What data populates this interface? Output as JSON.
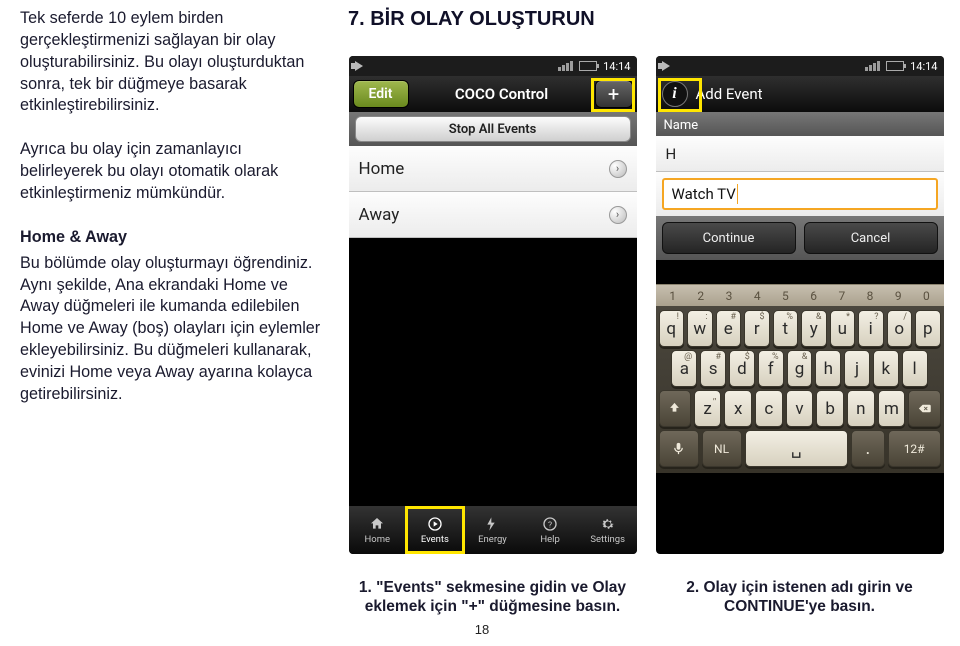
{
  "title": "7. BİR OLAY OLUŞTURUN",
  "para1a": "Tek seferde 10 eylem birden gerçekleştirmenizi sağlayan bir olay oluşturabilirsiniz. Bu olayı oluşturduktan sonra, tek bir düğmeye basarak etkinleştirebilirsiniz.",
  "para1b": "Ayrıca bu olay için zamanlayıcı belirleyerek bu olayı otomatik olarak etkinleştirmeniz mümkündür.",
  "subhead": "Home & Away",
  "para2": "Bu bölümde olay oluşturmayı öğrendiniz. Aynı şekilde, Ana ekrandaki Home ve Away düğmeleri ile kumanda edilebilen Home ve Away (boş) olayları için eylemler ekleyebilirsiniz. Bu düğmeleri kullanarak, evinizi Home veya Away ayarına kolayca getirebilirsiniz.",
  "caption1": "1. \"Events\" sekmesine gidin ve Olay eklemek için \"+\" düğmesine basın.",
  "caption2": "2. Olay için istenen adı girin ve CONTINUE'ye basın.",
  "page_num": "18",
  "phone_a": {
    "time": "14:14",
    "edit": "Edit",
    "header": "COCO Control",
    "plus": "+",
    "stop_all": "Stop All Events",
    "row1": "Home",
    "row2": "Away",
    "tabs": [
      "Home",
      "Events",
      "Energy",
      "Help",
      "Settings"
    ]
  },
  "phone_b": {
    "time": "14:14",
    "header": "Add Event",
    "name_label": "Name",
    "input_text": "Watch TV",
    "continue": "Continue",
    "cancel": "Cancel",
    "row_hint": "H",
    "strip": [
      "1",
      "2",
      "3",
      "4",
      "5",
      "6",
      "7",
      "8",
      "9",
      "0"
    ],
    "r1": [
      [
        "q",
        "!"
      ],
      [
        "w",
        ":"
      ],
      [
        "e",
        "#"
      ],
      [
        "r",
        "$"
      ],
      [
        "t",
        "%"
      ],
      [
        "y",
        "&"
      ],
      [
        "u",
        "*"
      ],
      [
        "i",
        "?"
      ],
      [
        "o",
        "/"
      ],
      [
        "p",
        ""
      ]
    ],
    "r2": [
      [
        "a",
        "@"
      ],
      [
        "s",
        "#"
      ],
      [
        "d",
        "$"
      ],
      [
        "f",
        "%"
      ],
      [
        "g",
        "&"
      ],
      [
        "h",
        ""
      ],
      [
        "j",
        ""
      ],
      [
        "k",
        ""
      ],
      [
        "l",
        ""
      ]
    ],
    "r3": [
      [
        "z",
        ",,"
      ],
      [
        "x",
        ""
      ],
      [
        "c",
        ""
      ],
      [
        "v",
        ""
      ],
      [
        "b",
        ""
      ],
      [
        "n",
        ""
      ],
      [
        "m",
        ""
      ]
    ],
    "lang": "NL",
    "numkey": "12#"
  }
}
